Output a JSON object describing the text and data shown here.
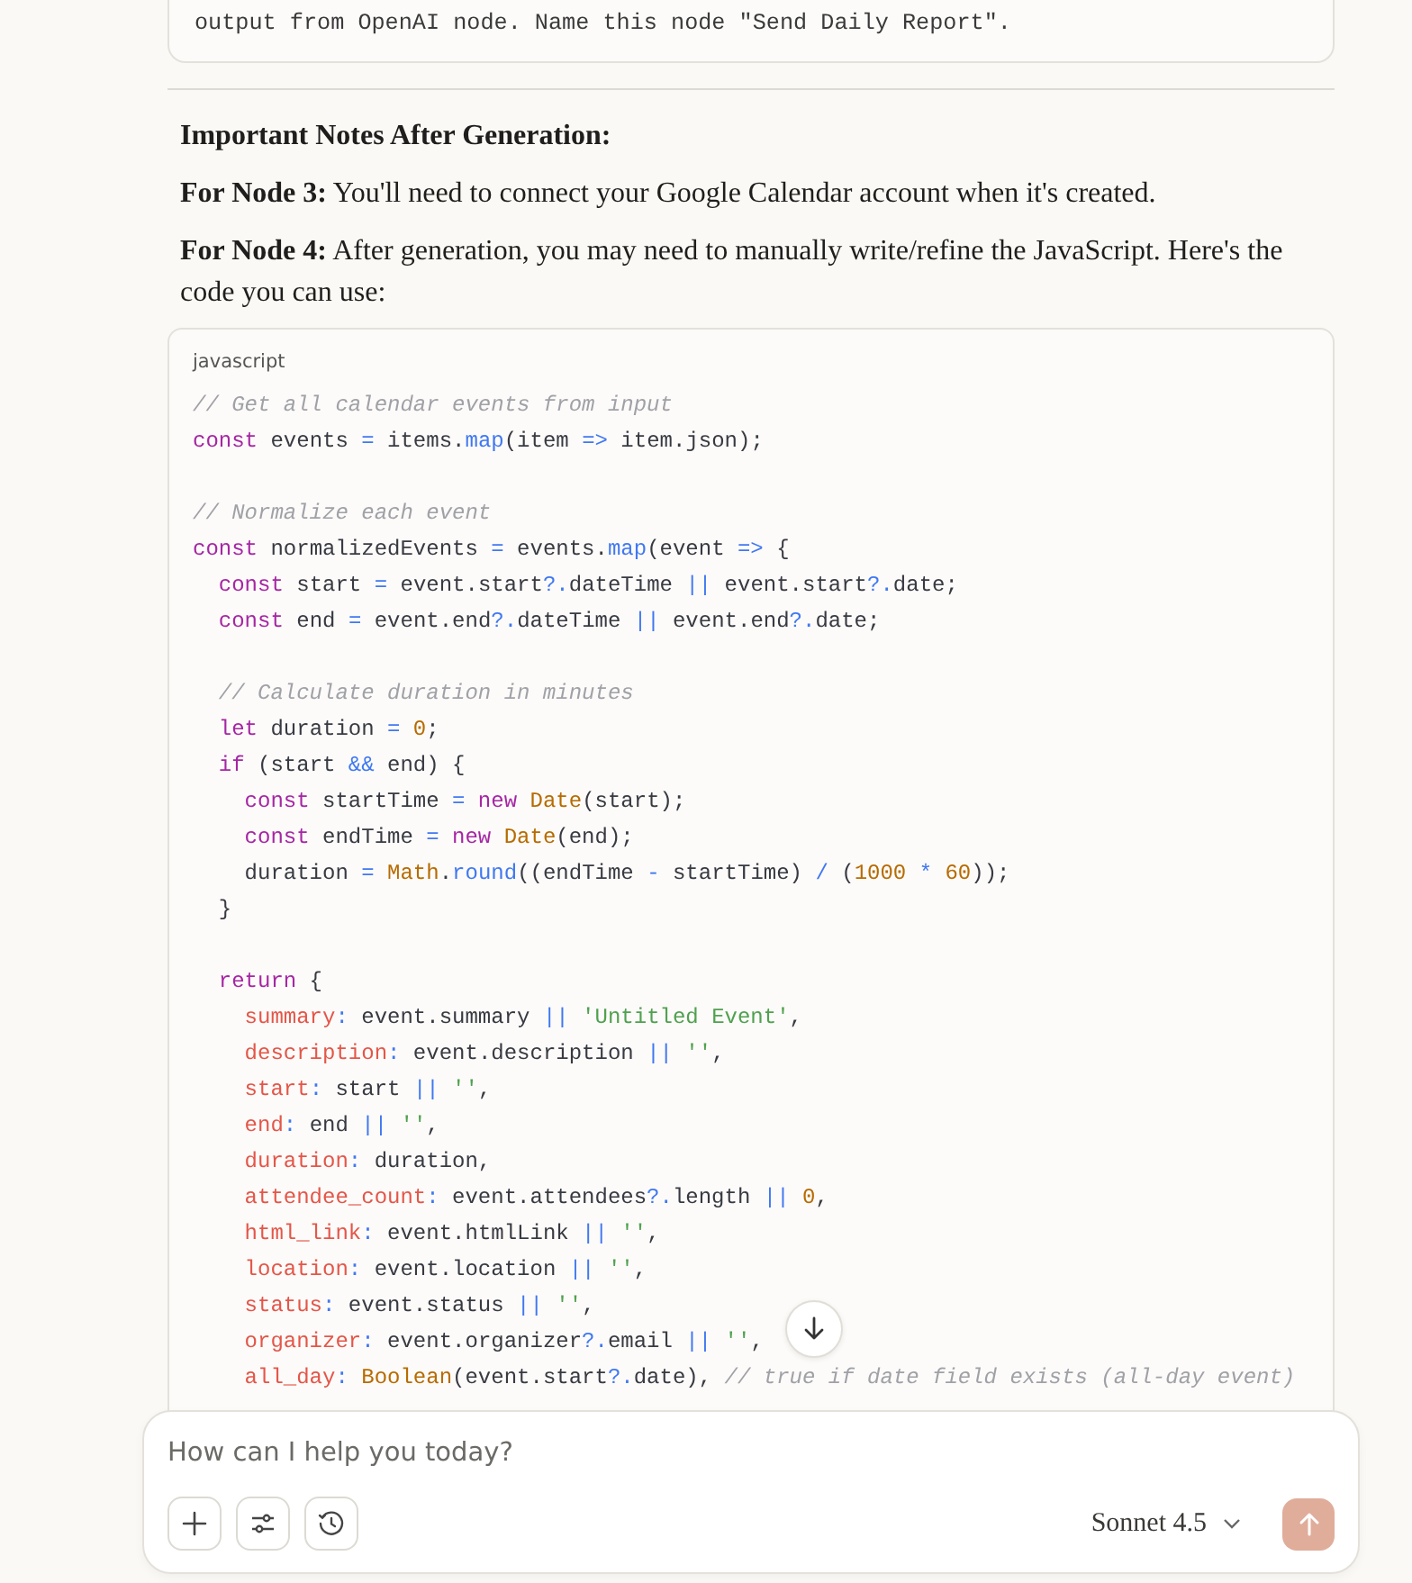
{
  "previous_code_tail": "output from OpenAI node. Name this node \"Send Daily Report\".",
  "notes": {
    "heading": "Important Notes After Generation:",
    "paragraphs": [
      "**For Node 3:** You'll need to connect your Google Calendar account when it's created.",
      "**For Node 4:** After generation, you may need to manually write/refine the JavaScript. Here's the code you can use:"
    ]
  },
  "code_block": {
    "language": "javascript",
    "lines": [
      {
        "kind": "code",
        "tokens": [
          {
            "kind": "comment",
            "text": "// Get all calendar events from input"
          }
        ]
      },
      {
        "kind": "code",
        "tokens": [
          {
            "kind": "keyword",
            "text": "const"
          },
          {
            "kind": "plain",
            "text": " events "
          },
          {
            "kind": "operator",
            "text": "="
          },
          {
            "kind": "plain",
            "text": " items."
          },
          {
            "kind": "function",
            "text": "map"
          },
          {
            "kind": "plain",
            "text": "(item "
          },
          {
            "kind": "operator",
            "text": "=>"
          },
          {
            "kind": "plain",
            "text": " item.json);"
          }
        ]
      },
      {
        "kind": "blank"
      },
      {
        "kind": "code",
        "tokens": [
          {
            "kind": "comment",
            "text": "// Normalize each event"
          }
        ]
      },
      {
        "kind": "code",
        "tokens": [
          {
            "kind": "keyword",
            "text": "const"
          },
          {
            "kind": "plain",
            "text": " normalizedEvents "
          },
          {
            "kind": "operator",
            "text": "="
          },
          {
            "kind": "plain",
            "text": " events."
          },
          {
            "kind": "function",
            "text": "map"
          },
          {
            "kind": "plain",
            "text": "(event "
          },
          {
            "kind": "operator",
            "text": "=>"
          },
          {
            "kind": "plain",
            "text": " {"
          }
        ]
      },
      {
        "kind": "code",
        "tokens": [
          {
            "kind": "keyword",
            "text": "  const"
          },
          {
            "kind": "plain",
            "text": " start "
          },
          {
            "kind": "operator",
            "text": "="
          },
          {
            "kind": "plain",
            "text": " event.start"
          },
          {
            "kind": "operator",
            "text": "?."
          },
          {
            "kind": "plain",
            "text": "dateTime "
          },
          {
            "kind": "operator",
            "text": "||"
          },
          {
            "kind": "plain",
            "text": " event.start"
          },
          {
            "kind": "operator",
            "text": "?."
          },
          {
            "kind": "plain",
            "text": "date;"
          }
        ]
      },
      {
        "kind": "code",
        "tokens": [
          {
            "kind": "keyword",
            "text": "  const"
          },
          {
            "kind": "plain",
            "text": " end "
          },
          {
            "kind": "operator",
            "text": "="
          },
          {
            "kind": "plain",
            "text": " event.end"
          },
          {
            "kind": "operator",
            "text": "?."
          },
          {
            "kind": "plain",
            "text": "dateTime "
          },
          {
            "kind": "operator",
            "text": "||"
          },
          {
            "kind": "plain",
            "text": " event.end"
          },
          {
            "kind": "operator",
            "text": "?."
          },
          {
            "kind": "plain",
            "text": "date;"
          }
        ]
      },
      {
        "kind": "blank"
      },
      {
        "kind": "code",
        "tokens": [
          {
            "kind": "comment",
            "text": "  // Calculate duration in minutes"
          }
        ]
      },
      {
        "kind": "code",
        "tokens": [
          {
            "kind": "keyword",
            "text": "  let"
          },
          {
            "kind": "plain",
            "text": " duration "
          },
          {
            "kind": "operator",
            "text": "="
          },
          {
            "kind": "number",
            "text": " 0"
          },
          {
            "kind": "plain",
            "text": ";"
          }
        ]
      },
      {
        "kind": "code",
        "tokens": [
          {
            "kind": "keyword",
            "text": "  if"
          },
          {
            "kind": "plain",
            "text": " (start "
          },
          {
            "kind": "operator",
            "text": "&&"
          },
          {
            "kind": "plain",
            "text": " end) {"
          }
        ]
      },
      {
        "kind": "code",
        "tokens": [
          {
            "kind": "keyword",
            "text": "    const"
          },
          {
            "kind": "plain",
            "text": " startTime "
          },
          {
            "kind": "operator",
            "text": "="
          },
          {
            "kind": "keyword",
            "text": " new"
          },
          {
            "kind": "class",
            "text": " Date"
          },
          {
            "kind": "plain",
            "text": "(start);"
          }
        ]
      },
      {
        "kind": "code",
        "tokens": [
          {
            "kind": "keyword",
            "text": "    const"
          },
          {
            "kind": "plain",
            "text": " endTime "
          },
          {
            "kind": "operator",
            "text": "="
          },
          {
            "kind": "keyword",
            "text": " new"
          },
          {
            "kind": "class",
            "text": " Date"
          },
          {
            "kind": "plain",
            "text": "(end);"
          }
        ]
      },
      {
        "kind": "code",
        "tokens": [
          {
            "kind": "plain",
            "text": "    duration "
          },
          {
            "kind": "operator",
            "text": "="
          },
          {
            "kind": "class",
            "text": " Math"
          },
          {
            "kind": "plain",
            "text": "."
          },
          {
            "kind": "function",
            "text": "round"
          },
          {
            "kind": "plain",
            "text": "((endTime "
          },
          {
            "kind": "operator",
            "text": "-"
          },
          {
            "kind": "plain",
            "text": " startTime) "
          },
          {
            "kind": "operator",
            "text": "/"
          },
          {
            "kind": "plain",
            "text": " ("
          },
          {
            "kind": "number",
            "text": "1000"
          },
          {
            "kind": "operator",
            "text": " * "
          },
          {
            "kind": "number",
            "text": "60"
          },
          {
            "kind": "plain",
            "text": "));"
          }
        ]
      },
      {
        "kind": "code",
        "tokens": [
          {
            "kind": "plain",
            "text": "  }"
          }
        ]
      },
      {
        "kind": "blank"
      },
      {
        "kind": "code",
        "tokens": [
          {
            "kind": "keyword",
            "text": "  return"
          },
          {
            "kind": "plain",
            "text": " {"
          }
        ]
      },
      {
        "kind": "code",
        "tokens": [
          {
            "kind": "property",
            "text": "    summary"
          },
          {
            "kind": "operator",
            "text": ":"
          },
          {
            "kind": "plain",
            "text": " event.summary "
          },
          {
            "kind": "operator",
            "text": "||"
          },
          {
            "kind": "string",
            "text": " 'Untitled Event'"
          },
          {
            "kind": "plain",
            "text": ","
          }
        ]
      },
      {
        "kind": "code",
        "tokens": [
          {
            "kind": "property",
            "text": "    description"
          },
          {
            "kind": "operator",
            "text": ":"
          },
          {
            "kind": "plain",
            "text": " event.description "
          },
          {
            "kind": "operator",
            "text": "||"
          },
          {
            "kind": "string",
            "text": " ''"
          },
          {
            "kind": "plain",
            "text": ","
          }
        ]
      },
      {
        "kind": "code",
        "tokens": [
          {
            "kind": "property",
            "text": "    start"
          },
          {
            "kind": "operator",
            "text": ":"
          },
          {
            "kind": "plain",
            "text": " start "
          },
          {
            "kind": "operator",
            "text": "||"
          },
          {
            "kind": "string",
            "text": " ''"
          },
          {
            "kind": "plain",
            "text": ","
          }
        ]
      },
      {
        "kind": "code",
        "tokens": [
          {
            "kind": "property",
            "text": "    end"
          },
          {
            "kind": "operator",
            "text": ":"
          },
          {
            "kind": "plain",
            "text": " end "
          },
          {
            "kind": "operator",
            "text": "||"
          },
          {
            "kind": "string",
            "text": " ''"
          },
          {
            "kind": "plain",
            "text": ","
          }
        ]
      },
      {
        "kind": "code",
        "tokens": [
          {
            "kind": "property",
            "text": "    duration"
          },
          {
            "kind": "operator",
            "text": ":"
          },
          {
            "kind": "plain",
            "text": " duration,"
          }
        ]
      },
      {
        "kind": "code",
        "tokens": [
          {
            "kind": "property",
            "text": "    attendee_count"
          },
          {
            "kind": "operator",
            "text": ":"
          },
          {
            "kind": "plain",
            "text": " event.attendees"
          },
          {
            "kind": "operator",
            "text": "?."
          },
          {
            "kind": "plain",
            "text": "length "
          },
          {
            "kind": "operator",
            "text": "||"
          },
          {
            "kind": "number",
            "text": " 0"
          },
          {
            "kind": "plain",
            "text": ","
          }
        ]
      },
      {
        "kind": "code",
        "tokens": [
          {
            "kind": "property",
            "text": "    html_link"
          },
          {
            "kind": "operator",
            "text": ":"
          },
          {
            "kind": "plain",
            "text": " event.htmlLink "
          },
          {
            "kind": "operator",
            "text": "||"
          },
          {
            "kind": "string",
            "text": " ''"
          },
          {
            "kind": "plain",
            "text": ","
          }
        ]
      },
      {
        "kind": "code",
        "tokens": [
          {
            "kind": "property",
            "text": "    location"
          },
          {
            "kind": "operator",
            "text": ":"
          },
          {
            "kind": "plain",
            "text": " event.location "
          },
          {
            "kind": "operator",
            "text": "||"
          },
          {
            "kind": "string",
            "text": " ''"
          },
          {
            "kind": "plain",
            "text": ","
          }
        ]
      },
      {
        "kind": "code",
        "tokens": [
          {
            "kind": "property",
            "text": "    status"
          },
          {
            "kind": "operator",
            "text": ":"
          },
          {
            "kind": "plain",
            "text": " event.status "
          },
          {
            "kind": "operator",
            "text": "||"
          },
          {
            "kind": "string",
            "text": " ''"
          },
          {
            "kind": "plain",
            "text": ","
          }
        ]
      },
      {
        "kind": "code",
        "tokens": [
          {
            "kind": "property",
            "text": "    organizer"
          },
          {
            "kind": "operator",
            "text": ":"
          },
          {
            "kind": "plain",
            "text": " event.organizer"
          },
          {
            "kind": "operator",
            "text": "?."
          },
          {
            "kind": "plain",
            "text": "email "
          },
          {
            "kind": "operator",
            "text": "||"
          },
          {
            "kind": "string",
            "text": " ''"
          },
          {
            "kind": "plain",
            "text": ","
          }
        ]
      },
      {
        "kind": "code",
        "tokens": [
          {
            "kind": "property",
            "text": "    all_day"
          },
          {
            "kind": "operator",
            "text": ":"
          },
          {
            "kind": "class",
            "text": " Boolean"
          },
          {
            "kind": "plain",
            "text": "(event.start"
          },
          {
            "kind": "operator",
            "text": "?."
          },
          {
            "kind": "plain",
            "text": "date), "
          },
          {
            "kind": "comment",
            "text": "// true if date field exists (all-day event)"
          }
        ]
      }
    ]
  },
  "composer": {
    "placeholder": "How can I help you today?",
    "model": "Sonnet 4.5",
    "send_disabled": true
  }
}
